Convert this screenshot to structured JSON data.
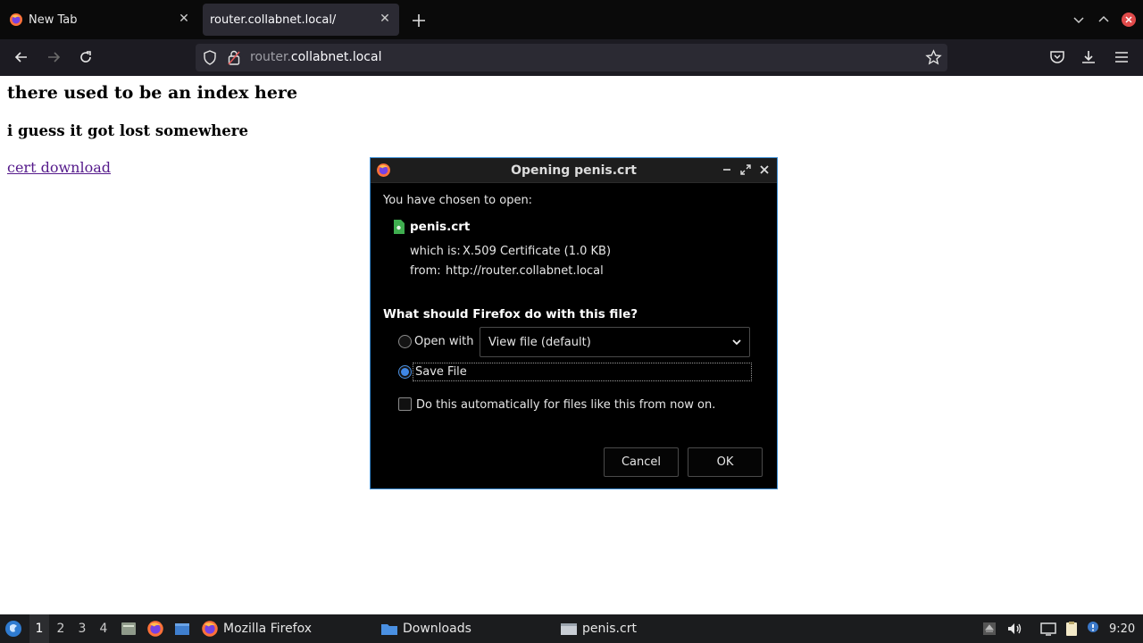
{
  "browser": {
    "tabs": [
      {
        "title": "New Tab",
        "active": false
      },
      {
        "title": "router.collabnet.local/",
        "active": true
      }
    ],
    "url": {
      "dim": "router.",
      "host": "collabnet.local"
    }
  },
  "page": {
    "heading": "there used to be an index here",
    "subheading": "i guess it got lost somewhere",
    "link": "cert download"
  },
  "dialog": {
    "title": "Opening penis.crt",
    "intro": "You have chosen to open:",
    "file_name": "penis.crt",
    "which_label": "which is:",
    "which_value": "X.509 Certificate (1.0 KB)",
    "from_label": "from:",
    "from_value": "http://router.collabnet.local",
    "question": "What should Firefox do with this file?",
    "open_with_label": "Open with",
    "app_select": "View file (default)",
    "save_label": "Save File",
    "selected_option": "Save File",
    "auto_label": "Do this automatically for files like this from now on.",
    "auto_checked": false,
    "cancel": "Cancel",
    "ok": "OK"
  },
  "taskbar": {
    "workspaces": [
      "1",
      "2",
      "3",
      "4"
    ],
    "active_workspace": "1",
    "tasks": [
      "Mozilla Firefox",
      "Downloads",
      "penis.crt"
    ],
    "clock": "9:20"
  },
  "colors": {
    "accent": "#3d8fd6",
    "link": "#551a8b",
    "tabbar": "#0a0a0a",
    "navbar": "#1c1b22",
    "urlbar": "#2b2a33",
    "taskbar": "#1b1c1e"
  },
  "icons": [
    "firefox-icon",
    "close-icon",
    "plus-icon",
    "back-icon",
    "forward-icon",
    "reload-icon",
    "shield-icon",
    "lock-icon",
    "star-icon",
    "pocket-icon",
    "download-icon",
    "menu-icon",
    "certificate-file-icon",
    "chevron-down-icon",
    "folder-icon",
    "file-icon",
    "speaker-icon",
    "notification-icon"
  ]
}
